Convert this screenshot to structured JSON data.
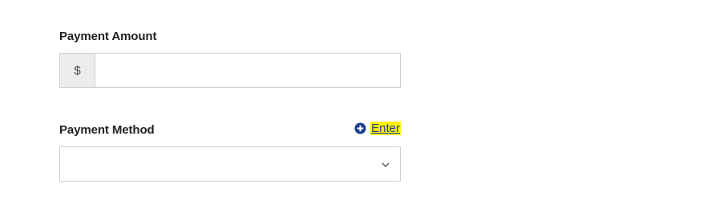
{
  "payment_amount": {
    "label": "Payment Amount",
    "currency_symbol": "$",
    "value": "",
    "placeholder": ""
  },
  "payment_method": {
    "label": "Payment Method",
    "selected": "",
    "enter_link": {
      "icon": "plus-circle-icon",
      "label": "Enter",
      "highlight_color": "#fff200",
      "link_color": "#1a3f8f"
    }
  }
}
